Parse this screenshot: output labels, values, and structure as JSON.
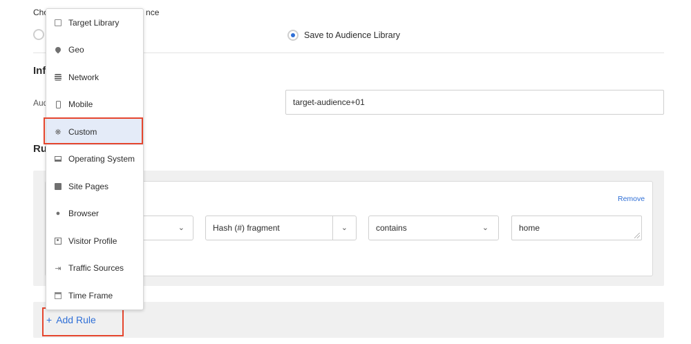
{
  "form": {
    "choose_label": "Cho",
    "choose_label_tail": "nce",
    "save_option_label": "Save to Audience Library",
    "info_heading": "Inf",
    "audience_label": "Aud",
    "audience_name_value": "target-audience+01",
    "rules_heading": "Ru"
  },
  "rule": {
    "remove_label": "Remove",
    "attribute_value": "Hash (#) fragment",
    "operator_value": "contains",
    "match_value": "home"
  },
  "add_rule": {
    "plus": "+",
    "label": "Add Rule"
  },
  "menu": {
    "items": [
      {
        "label": "Target Library",
        "icon": "library-icon"
      },
      {
        "label": "Geo",
        "icon": "location-pin-icon"
      },
      {
        "label": "Network",
        "icon": "database-icon"
      },
      {
        "label": "Mobile",
        "icon": "mobile-phone-icon"
      },
      {
        "label": "Custom",
        "icon": "custom-icon",
        "selected": true
      },
      {
        "label": "Operating System",
        "icon": "laptop-icon"
      },
      {
        "label": "Site Pages",
        "icon": "pages-icon"
      },
      {
        "label": "Browser",
        "icon": "globe-icon"
      },
      {
        "label": "Visitor Profile",
        "icon": "profile-icon"
      },
      {
        "label": "Traffic Sources",
        "icon": "traffic-icon"
      },
      {
        "label": "Time Frame",
        "icon": "calendar-icon"
      }
    ]
  },
  "colors": {
    "accent": "#2f6fd6",
    "highlight": "#e5452d",
    "selected_bg": "#e4ebf8"
  }
}
